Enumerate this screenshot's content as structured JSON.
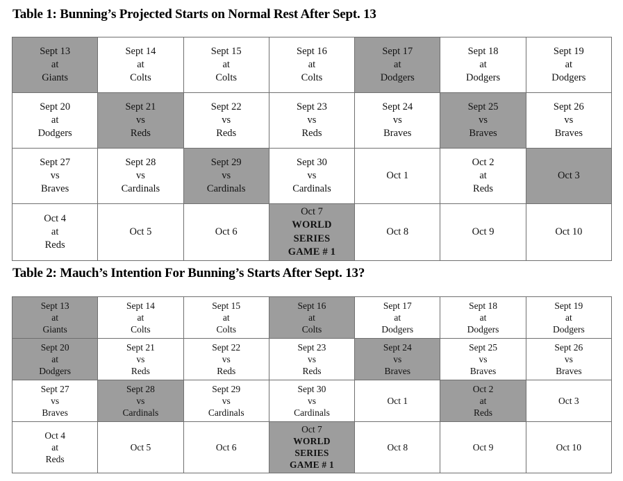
{
  "document": {
    "tables": [
      {
        "id": "table-1",
        "title": "Table 1: Bunning’s Projected Starts on Normal Rest After Sept. 13",
        "shaded_color": "#9d9d9d",
        "border_color": "#6f6f6f",
        "rows": [
          [
            {
              "lines": [
                "Sept 13",
                "at",
                "Giants"
              ],
              "shaded": true
            },
            {
              "lines": [
                "Sept 14",
                "at",
                "Colts"
              ],
              "shaded": false
            },
            {
              "lines": [
                "Sept 15",
                "at",
                "Colts"
              ],
              "shaded": false
            },
            {
              "lines": [
                "Sept 16",
                "at",
                "Colts"
              ],
              "shaded": false
            },
            {
              "lines": [
                "Sept 17",
                "at",
                "Dodgers"
              ],
              "shaded": true
            },
            {
              "lines": [
                "Sept 18",
                "at",
                "Dodgers"
              ],
              "shaded": false
            },
            {
              "lines": [
                "Sept 19",
                "at",
                "Dodgers"
              ],
              "shaded": false
            }
          ],
          [
            {
              "lines": [
                "Sept 20",
                "at",
                "Dodgers"
              ],
              "shaded": false
            },
            {
              "lines": [
                "Sept 21",
                "vs",
                "Reds"
              ],
              "shaded": true
            },
            {
              "lines": [
                "Sept 22",
                "vs",
                "Reds"
              ],
              "shaded": false
            },
            {
              "lines": [
                "Sept 23",
                "vs",
                "Reds"
              ],
              "shaded": false
            },
            {
              "lines": [
                "Sept 24",
                "vs",
                "Braves"
              ],
              "shaded": false
            },
            {
              "lines": [
                "Sept 25",
                "vs",
                "Braves"
              ],
              "shaded": true
            },
            {
              "lines": [
                "Sept 26",
                "vs",
                "Braves"
              ],
              "shaded": false
            }
          ],
          [
            {
              "lines": [
                "Sept 27",
                "vs",
                "Braves"
              ],
              "shaded": false
            },
            {
              "lines": [
                "Sept 28",
                "vs",
                "Cardinals"
              ],
              "shaded": false
            },
            {
              "lines": [
                "Sept 29",
                "vs",
                "Cardinals"
              ],
              "shaded": true
            },
            {
              "lines": [
                "Sept 30",
                "vs",
                "Cardinals"
              ],
              "shaded": false
            },
            {
              "lines": [
                "Oct 1"
              ],
              "shaded": false
            },
            {
              "lines": [
                "Oct 2",
                "at",
                "Reds"
              ],
              "shaded": false
            },
            {
              "lines": [
                "Oct 3"
              ],
              "shaded": true
            }
          ],
          [
            {
              "lines": [
                "Oct 4",
                "at",
                "Reds"
              ],
              "shaded": false
            },
            {
              "lines": [
                "Oct 5"
              ],
              "shaded": false
            },
            {
              "lines": [
                "Oct 6"
              ],
              "shaded": false
            },
            {
              "lines": [
                "Oct 7",
                "WORLD",
                "SERIES",
                "GAME # 1"
              ],
              "bold_lines": [
                false,
                true,
                true,
                true
              ],
              "shaded": true
            },
            {
              "lines": [
                "Oct 8"
              ],
              "shaded": false
            },
            {
              "lines": [
                "Oct 9"
              ],
              "shaded": false
            },
            {
              "lines": [
                "Oct 10"
              ],
              "shaded": false
            }
          ]
        ]
      },
      {
        "id": "table-2",
        "title": "Table 2: Mauch’s Intention For Bunning’s Starts After Sept. 13?",
        "shaded_color": "#9d9d9d",
        "border_color": "#6f6f6f",
        "rows": [
          [
            {
              "lines": [
                "Sept 13",
                "at",
                "Giants"
              ],
              "shaded": true
            },
            {
              "lines": [
                "Sept 14",
                "at",
                "Colts"
              ],
              "shaded": false
            },
            {
              "lines": [
                "Sept 15",
                "at",
                "Colts"
              ],
              "shaded": false
            },
            {
              "lines": [
                "Sept 16",
                "at",
                "Colts"
              ],
              "shaded": true
            },
            {
              "lines": [
                "Sept 17",
                "at",
                "Dodgers"
              ],
              "shaded": false
            },
            {
              "lines": [
                "Sept 18",
                "at",
                "Dodgers"
              ],
              "shaded": false
            },
            {
              "lines": [
                "Sept 19",
                "at",
                "Dodgers"
              ],
              "shaded": false
            }
          ],
          [
            {
              "lines": [
                "Sept 20",
                "at",
                "Dodgers"
              ],
              "shaded": true
            },
            {
              "lines": [
                "Sept 21",
                "vs",
                "Reds"
              ],
              "shaded": false
            },
            {
              "lines": [
                "Sept 22",
                "vs",
                "Reds"
              ],
              "shaded": false
            },
            {
              "lines": [
                "Sept 23",
                "vs",
                "Reds"
              ],
              "shaded": false
            },
            {
              "lines": [
                "Sept 24",
                "vs",
                "Braves"
              ],
              "shaded": true
            },
            {
              "lines": [
                "Sept 25",
                "vs",
                "Braves"
              ],
              "shaded": false
            },
            {
              "lines": [
                "Sept 26",
                "vs",
                "Braves"
              ],
              "shaded": false
            }
          ],
          [
            {
              "lines": [
                "Sept 27",
                "vs",
                "Braves"
              ],
              "shaded": false
            },
            {
              "lines": [
                "Sept 28",
                "vs",
                "Cardinals"
              ],
              "shaded": true
            },
            {
              "lines": [
                "Sept 29",
                "vs",
                "Cardinals"
              ],
              "shaded": false
            },
            {
              "lines": [
                "Sept 30",
                "vs",
                "Cardinals"
              ],
              "shaded": false
            },
            {
              "lines": [
                "Oct 1"
              ],
              "shaded": false
            },
            {
              "lines": [
                "Oct 2",
                "at",
                "Reds"
              ],
              "shaded": true
            },
            {
              "lines": [
                "Oct 3"
              ],
              "shaded": false
            }
          ],
          [
            {
              "lines": [
                "Oct 4",
                "at",
                "Reds"
              ],
              "shaded": false
            },
            {
              "lines": [
                "Oct 5"
              ],
              "shaded": false
            },
            {
              "lines": [
                "Oct 6"
              ],
              "shaded": false
            },
            {
              "lines": [
                "Oct 7",
                "WORLD",
                "SERIES",
                "GAME # 1"
              ],
              "bold_lines": [
                false,
                true,
                true,
                true
              ],
              "shaded": true
            },
            {
              "lines": [
                "Oct 8"
              ],
              "shaded": false
            },
            {
              "lines": [
                "Oct 9"
              ],
              "shaded": false
            },
            {
              "lines": [
                "Oct 10"
              ],
              "shaded": false
            }
          ]
        ]
      }
    ]
  }
}
